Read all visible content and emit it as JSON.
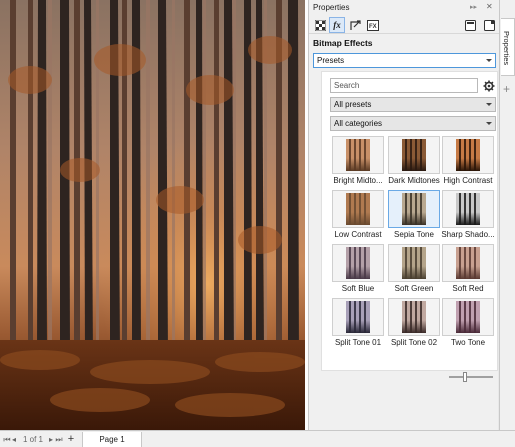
{
  "panel": {
    "title": "Properties",
    "section_title": "Bitmap Effects",
    "presets_dropdown": "Presets",
    "search_placeholder": "Search",
    "filter_presets": "All presets",
    "filter_categories": "All categories",
    "tabs": [
      {
        "icon": "checker-icon"
      },
      {
        "icon": "fx-icon"
      },
      {
        "icon": "transform-icon"
      },
      {
        "icon": "fx-star-icon"
      },
      {
        "icon": "frame-icon"
      },
      {
        "icon": "frame-corner-icon"
      }
    ],
    "presets": [
      {
        "label": "Bright Midto...",
        "tint": "#c89068",
        "dark": "#5a3a24"
      },
      {
        "label": "Dark Midtones",
        "tint": "#8a5a36",
        "dark": "#2a1a10"
      },
      {
        "label": "High Contrast",
        "tint": "#c67a45",
        "dark": "#2a1508"
      },
      {
        "label": "Low Contrast",
        "tint": "#b07a50",
        "dark": "#6a4a30"
      },
      {
        "label": "Sepia Tone",
        "tint": "#b8a890",
        "dark": "#3a3228"
      },
      {
        "label": "Sharp Shado...",
        "tint": "#c8c8c8",
        "dark": "#1a1a1a"
      },
      {
        "label": "Soft Blue",
        "tint": "#b4a0a8",
        "dark": "#4a3a48"
      },
      {
        "label": "Soft Green",
        "tint": "#b4a48a",
        "dark": "#4a4030"
      },
      {
        "label": "Soft Red",
        "tint": "#c8a090",
        "dark": "#5a3a32"
      },
      {
        "label": "Split Tone 01",
        "tint": "#a8a0b8",
        "dark": "#2a2838"
      },
      {
        "label": "Split Tone 02",
        "tint": "#c0a8a0",
        "dark": "#3a2a28"
      },
      {
        "label": "Two Tone",
        "tint": "#c0a0b0",
        "dark": "#4a2a38"
      }
    ],
    "selected_preset": 4
  },
  "pagebar": {
    "page_count": "1 of 1",
    "page_tab": "Page 1"
  },
  "dock": {
    "tab_label": "Properties"
  }
}
